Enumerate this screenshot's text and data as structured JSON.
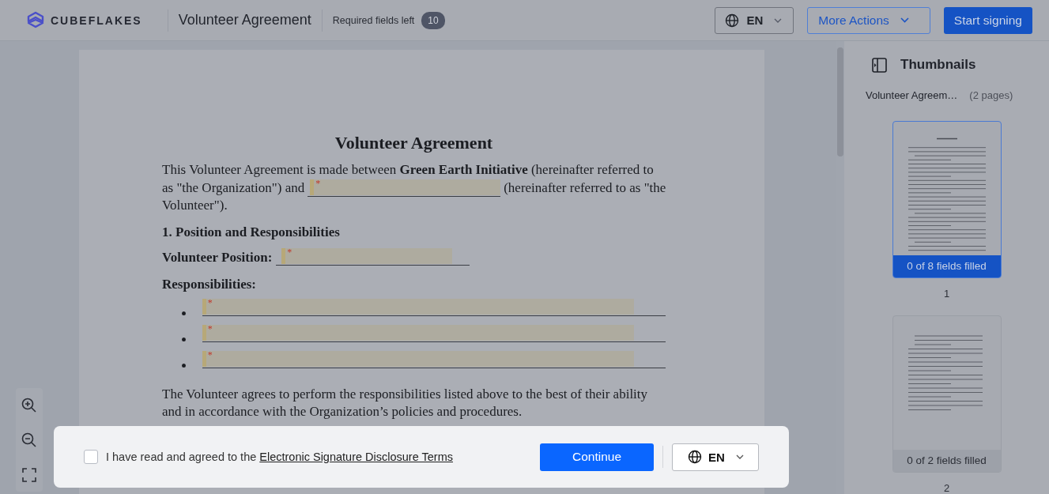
{
  "header": {
    "logo": "CUBEFLAKES",
    "title": "Volunteer Agreement",
    "required_label": "Required fields left",
    "required_count": "10",
    "language": "EN",
    "more_actions": "More Actions",
    "start_button": "Start signing"
  },
  "document": {
    "title": "Volunteer Agreement",
    "blocks": [
      {
        "kind": "lines",
        "lines": [
          [
            {
              "kind": "text",
              "text": "This Volunteer Agreement is made between **Green Earth Initiative** (hereinafter referred to"
            }
          ],
          [
            {
              "kind": "text",
              "text": "as \"the Organization\") and"
            },
            {
              "kind": "field",
              "marker": "*"
            },
            {
              "kind": "text",
              "text": "(hereinafter referred to as \"the"
            }
          ],
          [
            {
              "kind": "text",
              "text": "Volunteer\")."
            }
          ]
        ]
      },
      {
        "kind": "heading",
        "text": "1. Position and Responsibilities"
      },
      {
        "kind": "labeled_field",
        "label": "Volunteer Position:",
        "marker": "*"
      },
      {
        "kind": "heading",
        "text": "Responsibilities:"
      },
      {
        "kind": "bullets",
        "items": [
          {
            "marker": "*"
          },
          {
            "marker": "*"
          },
          {
            "marker": "*"
          }
        ]
      },
      {
        "kind": "paragraph",
        "parts": [
          {
            "kind": "text",
            "text": "The Volunteer agrees to perform the responsibilities listed above to the best of their ability and in accordance with the Organization’s policies and procedures."
          }
        ]
      }
    ]
  },
  "thumbnails": {
    "title": "Thumbnails",
    "doc_name": "Volunteer Agreem…",
    "page_count": "(2 pages)",
    "pages": [
      {
        "status": "0 of 8 fields filled",
        "number": "1",
        "selected": true
      },
      {
        "status": "0 of 2 fields filled",
        "number": "2",
        "selected": false
      }
    ]
  },
  "consent_bar": {
    "checked": false,
    "label": "I have read and agreed to the",
    "link": "Electronic Signature Disclosure Terms",
    "continue_button": "Continue",
    "language": "EN"
  }
}
